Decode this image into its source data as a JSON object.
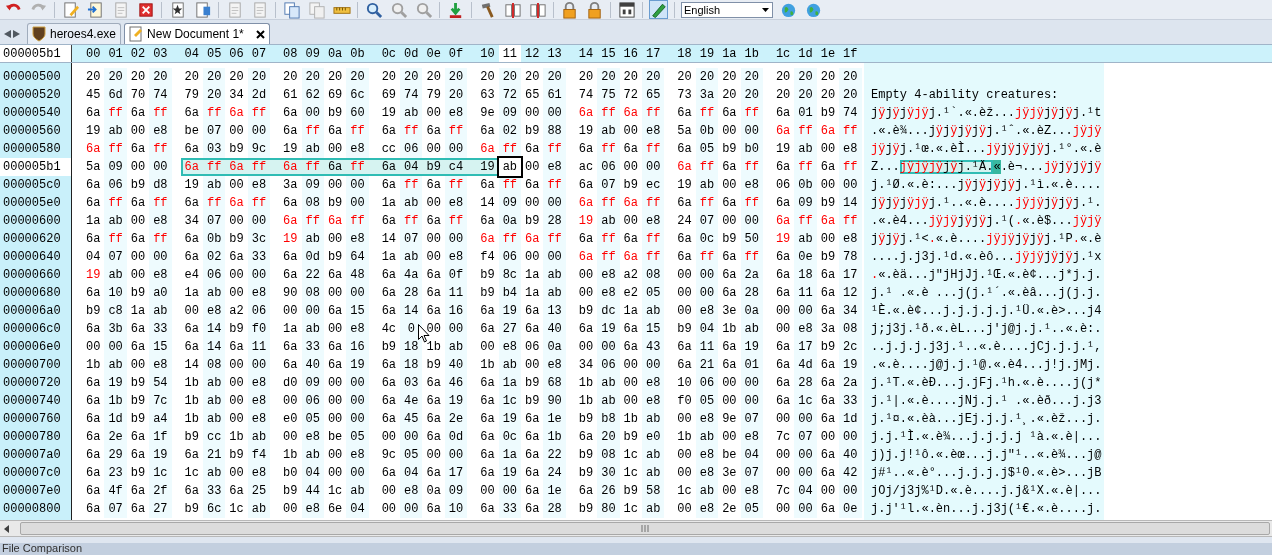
{
  "toolbar": {
    "language_select": {
      "value": "English"
    }
  },
  "tabs": [
    {
      "label": "heroes4.exe",
      "selected": false
    },
    {
      "label": "New Document 1*",
      "selected": true
    }
  ],
  "offset_field": {
    "value": "000005b1"
  },
  "columns": [
    {
      "label": "00",
      "selected": false
    },
    {
      "label": "01",
      "selected": false
    },
    {
      "label": "02",
      "selected": false
    },
    {
      "label": "03",
      "selected": false
    },
    {
      "label": "04",
      "selected": false
    },
    {
      "label": "05",
      "selected": false
    },
    {
      "label": "06",
      "selected": false
    },
    {
      "label": "07",
      "selected": false
    },
    {
      "label": "08",
      "selected": false
    },
    {
      "label": "09",
      "selected": false
    },
    {
      "label": "0a",
      "selected": false
    },
    {
      "label": "0b",
      "selected": false
    },
    {
      "label": "0c",
      "selected": false
    },
    {
      "label": "0d",
      "selected": false
    },
    {
      "label": "0e",
      "selected": false
    },
    {
      "label": "0f",
      "selected": false
    },
    {
      "label": "10",
      "selected": false
    },
    {
      "label": "11",
      "selected": true
    },
    {
      "label": "12",
      "selected": false
    },
    {
      "label": "13",
      "selected": false
    },
    {
      "label": "14",
      "selected": false
    },
    {
      "label": "15",
      "selected": false
    },
    {
      "label": "16",
      "selected": false
    },
    {
      "label": "17",
      "selected": false
    },
    {
      "label": "18",
      "selected": false
    },
    {
      "label": "19",
      "selected": false
    },
    {
      "label": "1a",
      "selected": false
    },
    {
      "label": "1b",
      "selected": false
    },
    {
      "label": "1c",
      "selected": false
    },
    {
      "label": "1d",
      "selected": false
    },
    {
      "label": "1e",
      "selected": false
    },
    {
      "label": "1f",
      "selected": false
    }
  ],
  "rows": [
    {
      "address": "00000500",
      "current": false,
      "hex": "20 20 20 20 20 20 20 20 20 20 20 20 20 20 20 20 20 20 20 20 20 20 20 20 20 20 20 20 20 20 20 20",
      "modified": [
        false,
        false,
        false,
        false,
        false,
        false,
        false,
        false,
        false,
        false,
        false,
        false,
        false,
        false,
        false,
        false,
        false,
        false,
        false,
        false,
        false,
        false,
        false,
        false,
        false,
        false,
        false,
        false,
        false,
        false,
        false,
        false
      ]
    },
    {
      "address": "00000520",
      "current": false,
      "hex": "45 6d 70 74 79 20 34 2d 61 62 69 6c 69 74 79 20 63 72 65 61 74 75 72 65 73 3a 20 20 20 20 20 20",
      "modified": [
        false,
        false,
        false,
        false,
        false,
        false,
        false,
        false,
        false,
        false,
        false,
        false,
        false,
        false,
        false,
        false,
        false,
        false,
        false,
        false,
        false,
        false,
        false,
        false,
        false,
        false,
        false,
        false,
        false,
        false,
        false,
        false
      ],
      "text": "Empty 4-ability creatures:"
    },
    {
      "address": "00000540",
      "current": false,
      "hex": "6a ff 6a ff 6a ff 6a ff 6a 00 b9 60 19 ab 00 e8 9e 09 00 00 6a ff 6a ff 6a ff 6a ff 6a 01 b9 74",
      "modified": [
        false,
        true,
        false,
        true,
        false,
        true,
        true,
        true,
        false,
        false,
        false,
        false,
        false,
        false,
        false,
        false,
        false,
        false,
        false,
        false,
        true,
        true,
        true,
        true,
        false,
        true,
        false,
        true,
        false,
        false,
        false,
        false
      ],
      "text": "jÿjÿjÿjÿj.¹`.«.èž...jÿjÿjÿjÿj.¹t"
    },
    {
      "address": "00000560",
      "current": false,
      "hex": "19 ab 00 e8 be 07 00 00 6a ff 6a ff 6a ff 6a ff 6a 02 b9 88 19 ab 00 e8 5a 0b 00 00 6a ff 6a ff",
      "modified": [
        false,
        false,
        false,
        false,
        false,
        false,
        false,
        false,
        false,
        true,
        false,
        true,
        false,
        true,
        false,
        true,
        false,
        false,
        false,
        false,
        false,
        false,
        false,
        false,
        false,
        false,
        false,
        false,
        true,
        true,
        true,
        true
      ],
      "text": ".«.è¾...jÿjÿjÿjÿj.¹ˆ.«.èZ...jÿjÿ"
    },
    {
      "address": "00000580",
      "current": false,
      "hex": "6a ff 6a ff 6a 03 b9 9c 19 ab 00 e8 cc 06 00 00 6a ff 6a ff 6a ff 6a ff 6a 05 b9 b0 19 ab 00 e8",
      "modified": [
        true,
        true,
        false,
        true,
        false,
        false,
        false,
        false,
        false,
        false,
        false,
        false,
        false,
        false,
        false,
        false,
        true,
        true,
        false,
        true,
        false,
        true,
        false,
        true,
        false,
        false,
        false,
        false,
        false,
        false,
        false,
        false
      ],
      "text": "jÿjÿj.¹œ.«.èÌ...jÿjÿjÿjÿj.¹°.«.è"
    },
    {
      "address": "000005b1",
      "current": true,
      "hex": "5a 09 00 00 6a ff 6a ff 6a ff 6a ff 6a 04 b9 c4 19 ab 00 e8 ac 06 00 00 6a ff 6a ff 6a ff 6a ff",
      "modified": [
        false,
        false,
        false,
        false,
        true,
        true,
        true,
        true,
        true,
        true,
        false,
        true,
        false,
        false,
        false,
        false,
        false,
        false,
        false,
        false,
        false,
        false,
        false,
        false,
        true,
        true,
        false,
        true,
        false,
        true,
        false,
        true
      ],
      "selected": [
        false,
        false,
        false,
        false,
        true,
        true,
        true,
        true,
        true,
        true,
        true,
        true,
        true,
        true,
        true,
        true,
        true,
        false,
        false,
        false,
        false,
        false,
        false,
        false,
        false,
        false,
        false,
        false,
        false,
        false,
        false,
        false
      ],
      "cursor": [
        false,
        false,
        false,
        false,
        false,
        false,
        false,
        false,
        false,
        false,
        false,
        false,
        false,
        false,
        false,
        false,
        false,
        true,
        false,
        false,
        false,
        false,
        false,
        false,
        false,
        false,
        false,
        false,
        false,
        false,
        false,
        false
      ],
      "text": "Z...jÿjÿjÿjÿj.¹Ä.«.è¬...jÿjÿjÿjÿ"
    },
    {
      "address": "000005c0",
      "current": false,
      "hex": "6a 06 b9 d8 19 ab 00 e8 3a 09 00 00 6a ff 6a ff 6a ff 6a ff 6a 07 b9 ec 19 ab 00 e8 06 0b 00 00",
      "modified": [
        false,
        false,
        false,
        false,
        false,
        false,
        false,
        false,
        false,
        false,
        false,
        false,
        false,
        true,
        false,
        true,
        false,
        true,
        false,
        true,
        false,
        false,
        false,
        false,
        false,
        false,
        false,
        false,
        false,
        false,
        false,
        false
      ],
      "text": "j.¹Ø.«.è:...jÿjÿjÿjÿj.¹ì.«.è...."
    },
    {
      "address": "000005e0",
      "current": false,
      "hex": "6a ff 6a ff 6a ff 6a ff 6a 08 b9 00 1a ab 00 e8 14 09 00 00 6a ff 6a ff 6a ff 6a ff 6a 09 b9 14",
      "modified": [
        false,
        true,
        false,
        true,
        false,
        true,
        true,
        true,
        false,
        false,
        false,
        false,
        false,
        false,
        false,
        false,
        false,
        false,
        false,
        false,
        true,
        true,
        true,
        true,
        false,
        true,
        false,
        true,
        false,
        false,
        false,
        false
      ],
      "text": "jÿjÿjÿjÿj.¹..«.è....jÿjÿjÿjÿj.¹."
    },
    {
      "address": "00000600",
      "current": false,
      "hex": "1a ab 00 e8 34 07 00 00 6a ff 6a ff 6a ff 6a ff 6a 0a b9 28 19 ab 00 e8 24 07 00 00 6a ff 6a ff",
      "modified": [
        false,
        false,
        false,
        false,
        false,
        false,
        false,
        false,
        true,
        true,
        true,
        true,
        false,
        true,
        false,
        true,
        false,
        false,
        false,
        false,
        true,
        false,
        false,
        false,
        false,
        false,
        false,
        false,
        true,
        true,
        true,
        true
      ],
      "text": ".«.è4...jÿjÿjÿjÿj.¹(.«.è$...jÿjÿ"
    },
    {
      "address": "00000620",
      "current": false,
      "hex": "6a ff 6a ff 6a 0b b9 3c 19 ab 00 e8 14 07 00 00 6a ff 6a ff 6a ff 6a ff 6a 0c b9 50 19 ab 00 e8",
      "modified": [
        false,
        true,
        false,
        true,
        false,
        false,
        false,
        false,
        true,
        false,
        false,
        false,
        false,
        false,
        false,
        false,
        true,
        true,
        true,
        true,
        false,
        true,
        false,
        true,
        false,
        false,
        false,
        false,
        true,
        false,
        false,
        false
      ],
      "text": "jÿjÿj.¹<.«.è....jÿjÿjÿjÿj.¹P.«.è"
    },
    {
      "address": "00000640",
      "current": false,
      "hex": "04 07 00 00 6a 02 6a 33 6a 0d b9 64 1a ab 00 e8 f4 06 00 00 6a ff 6a ff 6a ff 6a ff 6a 0e b9 78",
      "modified": [
        false,
        false,
        false,
        false,
        false,
        false,
        false,
        false,
        false,
        false,
        false,
        false,
        false,
        false,
        false,
        false,
        false,
        false,
        false,
        false,
        true,
        true,
        true,
        true,
        false,
        true,
        false,
        true,
        false,
        false,
        false,
        false
      ],
      "text": "....j.j3j.¹d.«.èô...jÿjÿjÿjÿj.¹x"
    },
    {
      "address": "00000660",
      "current": false,
      "hex": "19 ab 00 e8 e4 06 00 00 6a 22 6a 48 6a 4a 6a 0f b9 8c 1a ab 00 e8 a2 08 00 00 6a 2a 6a 18 6a 17",
      "modified": [
        true,
        false,
        false,
        false,
        false,
        false,
        false,
        false,
        false,
        false,
        false,
        false,
        false,
        false,
        false,
        false,
        false,
        false,
        false,
        false,
        false,
        false,
        false,
        false,
        false,
        false,
        false,
        false,
        false,
        false,
        false,
        false
      ],
      "text": ".«.èä...j\"jHjJj.¹Œ.«.è¢...j*j.j."
    },
    {
      "address": "00000680",
      "current": false,
      "hex": "6a 10 b9 a0 1a ab 00 e8 90 08 00 00 6a 28 6a 11 b9 b4 1a ab 00 e8 e2 05 00 00 6a 28 6a 11 6a 12",
      "modified": [
        false,
        false,
        false,
        false,
        false,
        false,
        false,
        false,
        false,
        false,
        false,
        false,
        false,
        false,
        false,
        false,
        false,
        false,
        false,
        false,
        false,
        false,
        false,
        false,
        false,
        false,
        false,
        false,
        false,
        false,
        false,
        false
      ],
      "text": "j.¹ .«.è ...j(j.¹´.«.èâ...j(j.j."
    },
    {
      "address": "000006a0",
      "current": false,
      "hex": "b9 c8 1a ab 00 e8 a2 06 00 00 6a 15 6a 14 6a 16 6a 19 6a 13 b9 dc 1a ab 00 e8 3e 0a 00 00 6a 34",
      "modified": [
        false,
        false,
        false,
        false,
        false,
        false,
        false,
        false,
        false,
        false,
        false,
        false,
        false,
        false,
        false,
        false,
        false,
        false,
        false,
        false,
        false,
        false,
        false,
        false,
        false,
        false,
        false,
        false,
        false,
        false,
        false,
        false
      ],
      "text": "¹È.«.è¢...j.j.j.j.j.¹Ü.«.è>...j4"
    },
    {
      "address": "000006c0",
      "current": false,
      "hex": "6a 3b 6a 33 6a 14 b9 f0 1a ab 00 e8 4c 0 00 00 6a 27 6a 40 6a 19 6a 15 b9 04 1b ab 00 e8 3a 08",
      "modified": [
        false,
        false,
        false,
        false,
        false,
        false,
        false,
        false,
        false,
        false,
        false,
        false,
        false,
        false,
        false,
        false,
        false,
        false,
        false,
        false,
        false,
        false,
        false,
        false,
        false,
        false,
        false,
        false,
        false,
        false,
        false,
        false
      ],
      "text": "j;j3j.¹ð.«.èL...j'j@j.j.¹..«.è:."
    },
    {
      "address": "000006e0",
      "current": false,
      "hex": "00 00 6a 15 6a 14 6a 11 6a 33 6a 16 b9 18 1b ab 00 e8 06 0a 00 00 6a 43 6a 11 6a 19 6a 17 b9 2c",
      "modified": [
        false,
        false,
        false,
        false,
        false,
        false,
        false,
        false,
        false,
        false,
        false,
        false,
        false,
        false,
        false,
        false,
        false,
        false,
        false,
        false,
        false,
        false,
        false,
        false,
        false,
        false,
        false,
        false,
        false,
        false,
        false,
        false
      ],
      "text": "..j.j.j.j3j.¹..«.è....jCj.j.j.¹,"
    },
    {
      "address": "00000700",
      "current": false,
      "hex": "1b ab 00 e8 14 08 00 00 6a 40 6a 19 6a 18 b9 40 1b ab 00 e8 34 06 00 00 6a 21 6a 01 6a 4d 6a 19",
      "modified": [
        false,
        false,
        false,
        false,
        false,
        false,
        false,
        false,
        false,
        false,
        false,
        false,
        false,
        false,
        false,
        false,
        false,
        false,
        false,
        false,
        false,
        false,
        false,
        false,
        false,
        false,
        false,
        false,
        false,
        false,
        false,
        false
      ],
      "text": ".«.è....j@j.j.¹@.«.è4...j!j.jMj."
    },
    {
      "address": "00000720",
      "current": false,
      "hex": "6a 19 b9 54 1b ab 00 e8 d0 09 00 00 6a 03 6a 46 6a 1a b9 68 1b ab 00 e8 10 06 00 00 6a 28 6a 2a",
      "modified": [
        false,
        false,
        false,
        false,
        false,
        false,
        false,
        false,
        false,
        false,
        false,
        false,
        false,
        false,
        false,
        false,
        false,
        false,
        false,
        false,
        false,
        false,
        false,
        false,
        false,
        false,
        false,
        false,
        false,
        false,
        false,
        false
      ],
      "text": "j.¹T.«.èÐ...j.jFj.¹h.«.è....j(j*"
    },
    {
      "address": "00000740",
      "current": false,
      "hex": "6a 1b b9 7c 1b ab 00 e8 00 06 00 00 6a 4e 6a 19 6a 1c b9 90 1b ab 00 e8 f0 05 00 00 6a 1c 6a 33",
      "modified": [
        false,
        false,
        false,
        false,
        false,
        false,
        false,
        false,
        false,
        false,
        false,
        false,
        false,
        false,
        false,
        false,
        false,
        false,
        false,
        false,
        false,
        false,
        false,
        false,
        false,
        false,
        false,
        false,
        false,
        false,
        false,
        false
      ],
      "text": "j.¹|.«.è....jNj.j.¹ .«.èð...j.j3"
    },
    {
      "address": "00000760",
      "current": false,
      "hex": "6a 1d b9 a4 1b ab 00 e8 e0 05 00 00 6a 45 6a 2e 6a 19 6a 1e b9 b8 1b ab 00 e8 9e 07 00 00 6a 1d",
      "modified": [
        false,
        false,
        false,
        false,
        false,
        false,
        false,
        false,
        false,
        false,
        false,
        false,
        false,
        false,
        false,
        false,
        false,
        false,
        false,
        false,
        false,
        false,
        false,
        false,
        false,
        false,
        false,
        false,
        false,
        false,
        false,
        false
      ],
      "text": "j.¹¤.«.èà...jEj.j.j.¹¸.«.èž...j."
    },
    {
      "address": "00000780",
      "current": false,
      "hex": "6a 2e 6a 1f b9 cc 1b ab 00 e8 be 05 00 00 6a 0d 6a 0c 6a 1b 6a 20 b9 e0 1b ab 00 e8 7c 07 00 00",
      "modified": [
        false,
        false,
        false,
        false,
        false,
        false,
        false,
        false,
        false,
        false,
        false,
        false,
        false,
        false,
        false,
        false,
        false,
        false,
        false,
        false,
        false,
        false,
        false,
        false,
        false,
        false,
        false,
        false,
        false,
        false,
        false,
        false
      ],
      "text": "j.j.¹Ì.«.è¾...j.j.j.j ¹à.«.è|..."
    },
    {
      "address": "000007a0",
      "current": false,
      "hex": "6a 29 6a 19 6a 21 b9 f4 1b ab 00 e8 9c 05 00 00 6a 1a 6a 22 b9 08 1c ab 00 e8 be 04 00 00 6a 40",
      "modified": [
        false,
        false,
        false,
        false,
        false,
        false,
        false,
        false,
        false,
        false,
        false,
        false,
        false,
        false,
        false,
        false,
        false,
        false,
        false,
        false,
        false,
        false,
        false,
        false,
        false,
        false,
        false,
        false,
        false,
        false,
        false,
        false
      ],
      "text": "j)j.j!¹ô.«.èœ...j.j\"¹..«.è¾...j@"
    },
    {
      "address": "000007c0",
      "current": false,
      "hex": "6a 23 b9 1c 1c ab 00 e8 b0 04 00 00 6a 04 6a 17 6a 19 6a 24 b9 30 1c ab 00 e8 3e 07 00 00 6a 42",
      "modified": [
        false,
        false,
        false,
        false,
        false,
        false,
        false,
        false,
        false,
        false,
        false,
        false,
        false,
        false,
        false,
        false,
        false,
        false,
        false,
        false,
        false,
        false,
        false,
        false,
        false,
        false,
        false,
        false,
        false,
        false,
        false,
        false
      ],
      "text": "j#¹..«.è°...j.j.j.j$¹0.«.è>...jB"
    },
    {
      "address": "000007e0",
      "current": false,
      "hex": "6a 4f 6a 2f 6a 33 6a 25 b9 44 1c ab 00 e8 0a 09 00 00 6a 1e 6a 26 b9 58 1c ab 00 e8 7c 04 00 00",
      "modified": [
        false,
        false,
        false,
        false,
        false,
        false,
        false,
        false,
        false,
        false,
        false,
        false,
        false,
        false,
        false,
        false,
        false,
        false,
        false,
        false,
        false,
        false,
        false,
        false,
        false,
        false,
        false,
        false,
        false,
        false,
        false,
        false
      ],
      "text": "jOj/j3j%¹D.«.è....j.j&¹X.«.è|..."
    },
    {
      "address": "00000800",
      "current": false,
      "hex": "6a 07 6a 27 b9 6c 1c ab 00 e8 6e 04 00 00 6a 10 6a 33 6a 28 b9 80 1c ab 00 e8 2e 05 00 00 6a 0e",
      "modified": [
        false,
        false,
        false,
        false,
        false,
        false,
        false,
        false,
        false,
        false,
        false,
        false,
        false,
        false,
        false,
        false,
        false,
        false,
        false,
        false,
        false,
        false,
        false,
        false,
        false,
        false,
        false,
        false,
        false,
        false,
        false,
        false
      ],
      "text": "j.j'¹l.«.èn...j.j3j(¹€.«.è....j."
    }
  ],
  "bottom_panel": {
    "title": "File Comparison"
  }
}
